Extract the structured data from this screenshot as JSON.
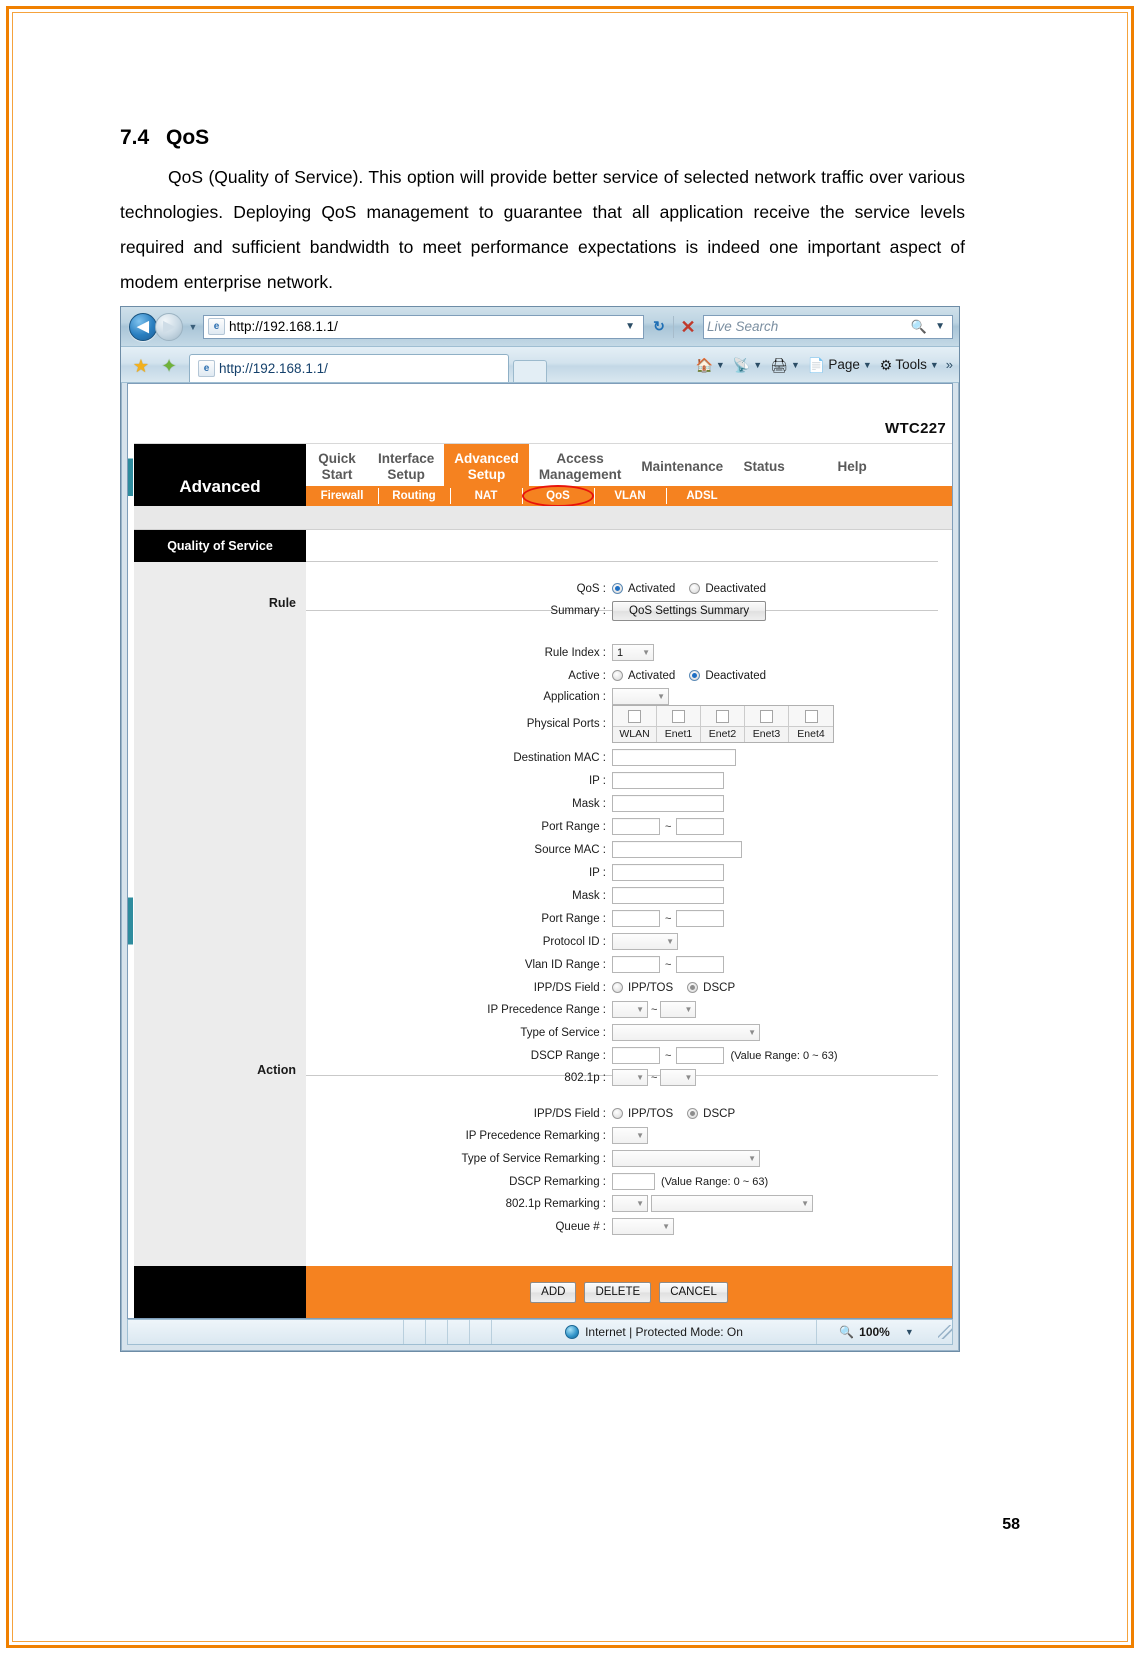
{
  "document": {
    "heading_number": "7.4",
    "heading_title": "QoS",
    "paragraph": "QoS (Quality of Service). This option will provide better service of selected network traffic over various technologies. Deploying QoS management to guarantee that all application receive the service levels required and sufficient bandwidth to meet performance expectations is indeed one important aspect of modem enterprise network.",
    "page_number": "58"
  },
  "browser": {
    "url": "http://192.168.1.1/",
    "tab_title": "http://192.168.1.1/",
    "search_placeholder": "Live Search",
    "back_icon": "back-arrow-icon",
    "forward_icon": "forward-arrow-icon",
    "refresh_icon": "refresh-icon",
    "stop_icon": "stop-icon",
    "commands": [
      {
        "label": "",
        "icon": "home-icon",
        "caret": true
      },
      {
        "label": "",
        "icon": "rss-feeds-icon",
        "caret": true
      },
      {
        "label": "",
        "icon": "print-icon",
        "caret": true
      },
      {
        "label": "Page",
        "icon": "page-icon",
        "caret": true
      },
      {
        "label": "Tools",
        "icon": "tools-gear-icon",
        "caret": true
      }
    ],
    "overflow_icon": "double-chevron-icon",
    "statusbar": {
      "zone_text": "Internet | Protected Mode: On",
      "zone_icon": "internet-zone-icon",
      "zoom_level": "100%",
      "zoom_icon": "magnifier-icon"
    }
  },
  "router": {
    "logo": "WTC227",
    "nav_title": "Advanced",
    "main_tabs": [
      {
        "label": "Quick\nStart",
        "line1": "Quick",
        "line2": "Start",
        "active": false
      },
      {
        "label": "Interface Setup",
        "line1": "Interface",
        "line2": "Setup",
        "active": false
      },
      {
        "label": "Advanced Setup",
        "line1": "Advanced",
        "line2": "Setup",
        "active": true
      },
      {
        "label": "Access Management",
        "line1": "Access",
        "line2": "Management",
        "active": false
      },
      {
        "label": "Maintenance",
        "line1": "Maintenance",
        "line2": "",
        "active": false
      },
      {
        "label": "Status",
        "line1": "Status",
        "line2": "",
        "active": false
      },
      {
        "label": "Help",
        "line1": "Help",
        "line2": "",
        "active": false
      }
    ],
    "sub_tabs": [
      {
        "label": "Firewall",
        "highlighted": false
      },
      {
        "label": "Routing",
        "highlighted": false
      },
      {
        "label": "NAT",
        "highlighted": false
      },
      {
        "label": "QoS",
        "highlighted": true
      },
      {
        "label": "VLAN",
        "highlighted": false
      },
      {
        "label": "ADSL",
        "highlighted": false
      }
    ],
    "section_title": "Quality of Service",
    "sidebar_labels": {
      "rule": "Rule",
      "action": "Action"
    },
    "qos": {
      "qos_label": "QoS :",
      "qos_activated": "Activated",
      "qos_deactivated": "Deactivated",
      "qos_selected": "Activated",
      "summary_label": "Summary :",
      "summary_button": "QoS Settings Summary"
    },
    "rule": {
      "rule_index_label": "Rule Index :",
      "rule_index_value": "1",
      "active_label": "Active :",
      "active_activated": "Activated",
      "active_deactivated": "Deactivated",
      "active_selected": "Deactivated",
      "application_label": "Application :",
      "application_value": "",
      "physical_ports_label": "Physical Ports :",
      "ports": [
        {
          "name": "WLAN",
          "checked": false
        },
        {
          "name": "Enet1",
          "checked": false
        },
        {
          "name": "Enet2",
          "checked": false
        },
        {
          "name": "Enet3",
          "checked": false
        },
        {
          "name": "Enet4",
          "checked": false
        }
      ],
      "destination_mac_label": "Destination MAC :",
      "destination_mac_value": "",
      "dest_ip_label": "IP :",
      "dest_ip_value": "",
      "dest_mask_label": "Mask :",
      "dest_mask_value": "",
      "dest_port_range_label": "Port Range :",
      "dest_port_from": "",
      "dest_port_to": "",
      "source_mac_label": "Source MAC :",
      "source_mac_value": "",
      "src_ip_label": "IP :",
      "src_ip_value": "",
      "src_mask_label": "Mask :",
      "src_mask_value": "",
      "src_port_range_label": "Port Range :",
      "src_port_from": "",
      "src_port_to": "",
      "protocol_id_label": "Protocol ID :",
      "protocol_id_value": "",
      "vlan_id_range_label": "Vlan ID Range :",
      "vlan_from": "",
      "vlan_to": "",
      "ippds_field_label": "IPP/DS Field :",
      "ipptos_label": "IPP/TOS",
      "dscp_label": "DSCP",
      "ippds_selected": "DSCP",
      "ip_precedence_range_label": "IP Precedence Range :",
      "ip_prec_from": "",
      "ip_prec_to": "",
      "type_of_service_label": "Type of Service :",
      "type_of_service_value": "",
      "dscp_range_label": "DSCP Range :",
      "dscp_from": "",
      "dscp_to": "",
      "dscp_note": "(Value Range: 0 ~ 63)",
      "dot1p_label": "802.1p :",
      "dot1p_from": "",
      "dot1p_to": ""
    },
    "action": {
      "ippds_field_label": "IPP/DS Field :",
      "ipptos_label": "IPP/TOS",
      "dscp_label": "DSCP",
      "ippds_selected": "DSCP",
      "ip_precedence_remarking_label": "IP Precedence Remarking :",
      "ip_precedence_remarking_value": "",
      "type_of_service_remarking_label": "Type of Service Remarking :",
      "type_of_service_remarking_value": "",
      "dscp_remarking_label": "DSCP Remarking :",
      "dscp_remarking_value": "",
      "dscp_remarking_note": "(Value Range: 0 ~ 63)",
      "dot1p_remarking_label": "802.1p Remarking :",
      "dot1p_remarking_value": "",
      "dot1p_remarking_value2": "",
      "queue_label": "Queue # :",
      "queue_value": ""
    },
    "buttons": {
      "add": "ADD",
      "delete": "DELETE",
      "cancel": "CANCEL"
    }
  }
}
